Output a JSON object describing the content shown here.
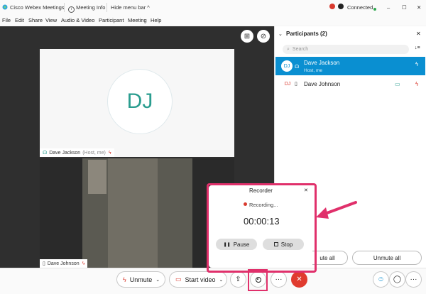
{
  "title_bar": {
    "app_name": "Cisco Webex Meetings",
    "meeting_info": "Meeting Info",
    "hide_menu": "Hide menu bar",
    "hide_menu_caret": "^",
    "connection": "Connected",
    "window_controls": {
      "minimize": "–",
      "maximize": "☐",
      "close": "✕"
    }
  },
  "menu": [
    "File",
    "Edit",
    "Share",
    "View",
    "Audio & Video",
    "Participant",
    "Meeting",
    "Help"
  ],
  "stage": {
    "host_initials": "DJ",
    "host_caption": "Dave Jackson",
    "host_caption_role": "(Host, me)",
    "guest_caption": "Dave Johnson"
  },
  "participants": {
    "header": "Participants (2)",
    "search_placeholder": "Search",
    "close": "✕",
    "sort_icon": "↓≡",
    "items": [
      {
        "initials": "DJ",
        "name": "Dave Jackson",
        "role": "Host, me"
      },
      {
        "initials": "DJ",
        "name": "Dave Johnson",
        "role": ""
      }
    ],
    "mute_all_label": "ute all",
    "unmute_all_label": "Unmute all"
  },
  "recorder": {
    "title": "Recorder",
    "close": "✕",
    "status": "Recording...",
    "time": "00:00:13",
    "pause_label": "Pause",
    "stop_label": "Stop"
  },
  "toolbar": {
    "unmute_label": "Unmute",
    "start_video_label": "Start video",
    "more_label": "···",
    "end_label": "✕",
    "caret": "⌄"
  },
  "colors": {
    "accent_blue": "#0a8fd1",
    "annotation_pink": "#e0306b",
    "end_red": "#e03b2f",
    "teal": "#2a9d8f"
  }
}
